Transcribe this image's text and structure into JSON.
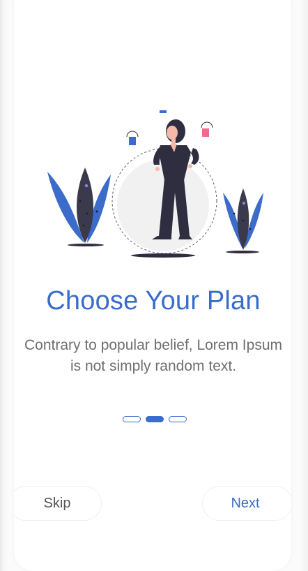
{
  "onboarding": {
    "title": "Choose Your Plan",
    "subtitle": "Contrary to popular belief, Lorem Ipsum is not simply random text.",
    "pagination": {
      "total": 3,
      "active_index": 2
    },
    "skip_label": "Skip",
    "next_label": "Next"
  },
  "colors": {
    "accent": "#3b6cc9",
    "text_muted": "#6f6f72",
    "paint_pink": "#f06a8a",
    "plant_dark": "#3a3a4c",
    "figure": "#2f2e41"
  },
  "icons": {
    "illustration": "woman-with-paint-buckets-illustration"
  }
}
